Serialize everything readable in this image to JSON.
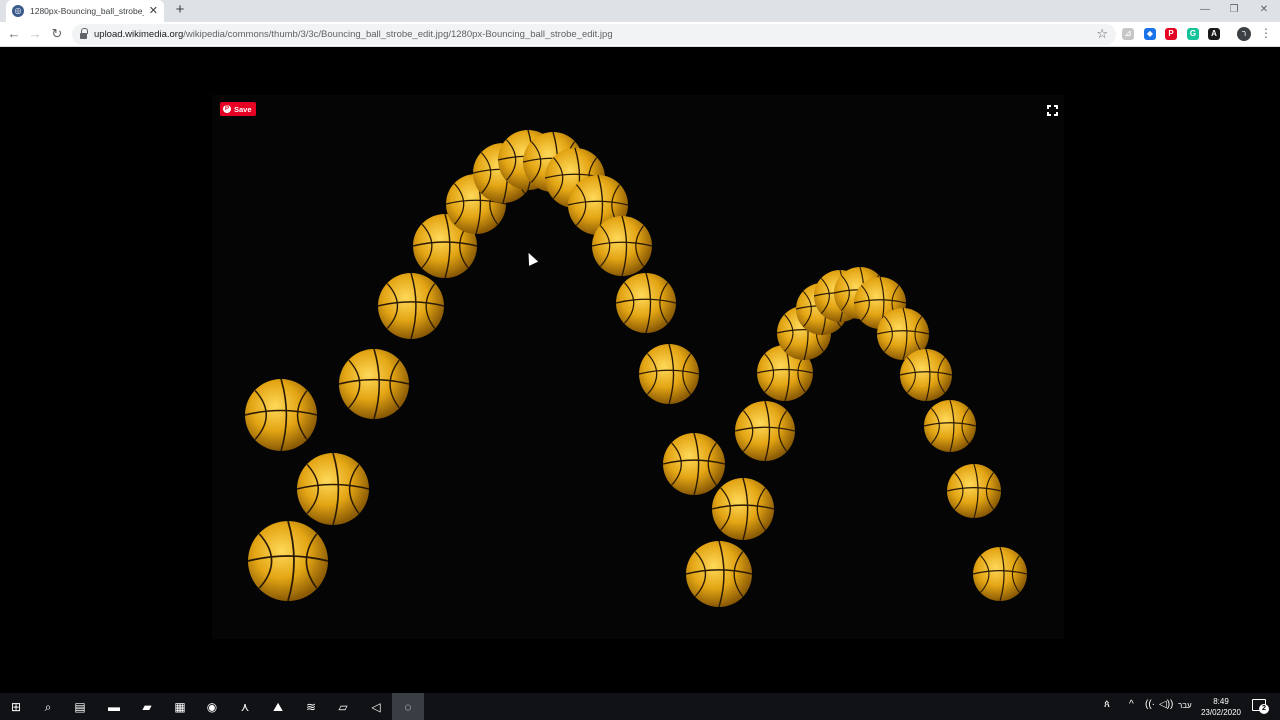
{
  "browser": {
    "tab_title": "1280px-Bouncing_ball_strobe_e...",
    "tab_close": "✕",
    "new_tab": "+",
    "back": "←",
    "forward": "→",
    "reload": "↻",
    "url_host": "upload.wikimedia.org",
    "url_path": "/wikipedia/commons/thumb/3/3c/Bouncing_ball_strobe_edit.jpg/1280px-Bouncing_ball_strobe_edit.jpg",
    "bookmark_star": "☆",
    "profile_initial": "ר",
    "menu": "⋮",
    "window_minimize": "—",
    "window_restore": "❐",
    "window_close": "✕"
  },
  "extensions": [
    {
      "name": "acrobat-extension-icon",
      "glyph": "⊿",
      "color": "#c6c6c6"
    },
    {
      "name": "dropbox-extension-icon",
      "glyph": "◆",
      "color": "#1a73e8"
    },
    {
      "name": "pinterest-extension-icon",
      "glyph": "P",
      "color": "#e60023"
    },
    {
      "name": "grammarly-extension-icon",
      "glyph": "G",
      "color": "#15c39a"
    },
    {
      "name": "a-extension-icon",
      "glyph": "A",
      "color": "#1a1a1a"
    }
  ],
  "content": {
    "save_label": "Save",
    "pin_glyph": "P"
  },
  "taskbar": {
    "apps": [
      {
        "name": "start-button",
        "glyph": "⊞"
      },
      {
        "name": "search-icon",
        "glyph": "⌕"
      },
      {
        "name": "task-view-icon",
        "glyph": "▤"
      },
      {
        "name": "file-explorer-icon",
        "glyph": "▬"
      },
      {
        "name": "sticky-notes-icon",
        "glyph": "▰"
      },
      {
        "name": "app-icon",
        "glyph": "▦"
      },
      {
        "name": "chrome-icon",
        "glyph": "◉"
      },
      {
        "name": "acrobat-icon",
        "glyph": "⋏"
      },
      {
        "name": "photos-icon",
        "glyph": "⛰"
      },
      {
        "name": "spotify-icon",
        "glyph": "≋"
      },
      {
        "name": "notepad-icon",
        "glyph": "▱"
      },
      {
        "name": "visual-studio-icon",
        "glyph": "◁"
      },
      {
        "name": "obs-icon",
        "glyph": "◌"
      }
    ],
    "tray_people": "ጰ",
    "tray_chevron": "^",
    "tray_wifi": "((·",
    "tray_volume": "◁))",
    "language": "עבר",
    "time": "8:49",
    "date": "23/02/2020",
    "notifications_count": "2"
  }
}
